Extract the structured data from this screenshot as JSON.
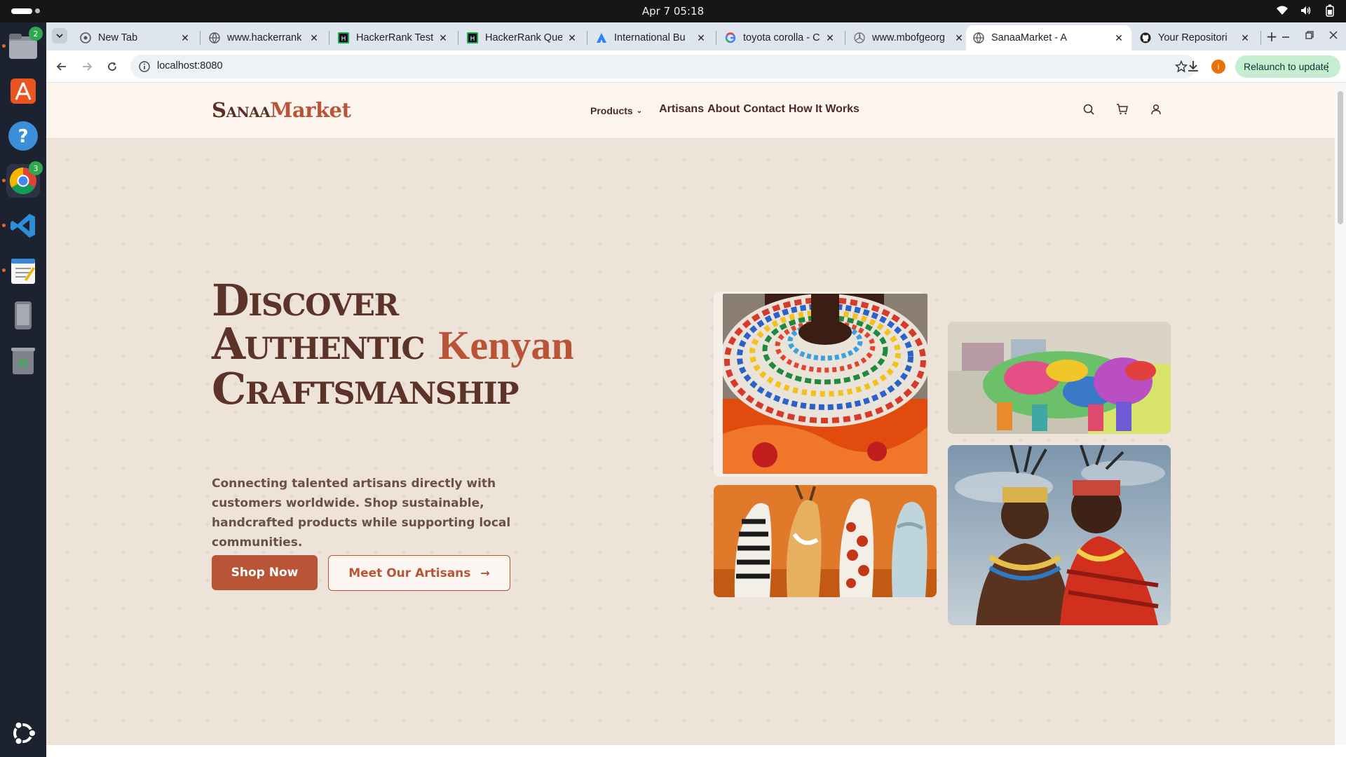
{
  "system": {
    "clock": "Apr 7  05:18"
  },
  "dock": {
    "items": [
      {
        "name": "files",
        "badge": "2"
      },
      {
        "name": "app-center",
        "badge": ""
      },
      {
        "name": "help",
        "badge": ""
      },
      {
        "name": "chrome",
        "badge": "3"
      },
      {
        "name": "vscode",
        "badge": ""
      },
      {
        "name": "text-editor",
        "badge": ""
      },
      {
        "name": "device",
        "badge": ""
      },
      {
        "name": "trash",
        "badge": ""
      }
    ]
  },
  "browser": {
    "tabs": [
      {
        "title": "New Tab",
        "icon": "chrome-icon"
      },
      {
        "title": "www.hackerrank",
        "icon": "globe-icon"
      },
      {
        "title": "HackerRank Test",
        "icon": "hackerrank-icon"
      },
      {
        "title": "HackerRank Que",
        "icon": "hackerrank-icon"
      },
      {
        "title": "International Bu",
        "icon": "atlassian-icon"
      },
      {
        "title": "toyota corolla - C",
        "icon": "google-icon"
      },
      {
        "title": "www.mbofgeorg",
        "icon": "mercedes-icon"
      },
      {
        "title": "SanaaMarket - A",
        "icon": "globe-icon"
      },
      {
        "title": "Your Repositori",
        "icon": "github-icon"
      }
    ],
    "active_tab": 7,
    "url": "localhost:8080",
    "profile_initial": "i",
    "relaunch_label": "Relaunch to update"
  },
  "site": {
    "logo_part1": "Sanaa",
    "logo_part2": "Market",
    "nav": {
      "products": "Products",
      "links": [
        "Artisans",
        "About",
        "Contact",
        "How It Works"
      ]
    },
    "hero": {
      "title_line1": "Discover",
      "title_line2a": "Authentic",
      "title_line2b": "Kenyan",
      "title_line3": "Craftsmanship",
      "subtitle": "Connecting talented artisans directly with customers worldwide. Shop sustainable, handcrafted products while supporting local communities.",
      "primary_cta": "Shop Now",
      "secondary_cta": "Meet Our Artisans"
    },
    "colors": {
      "brand": "#b95436",
      "brand_dark": "#5b3328",
      "background": "#ede3d9"
    }
  }
}
